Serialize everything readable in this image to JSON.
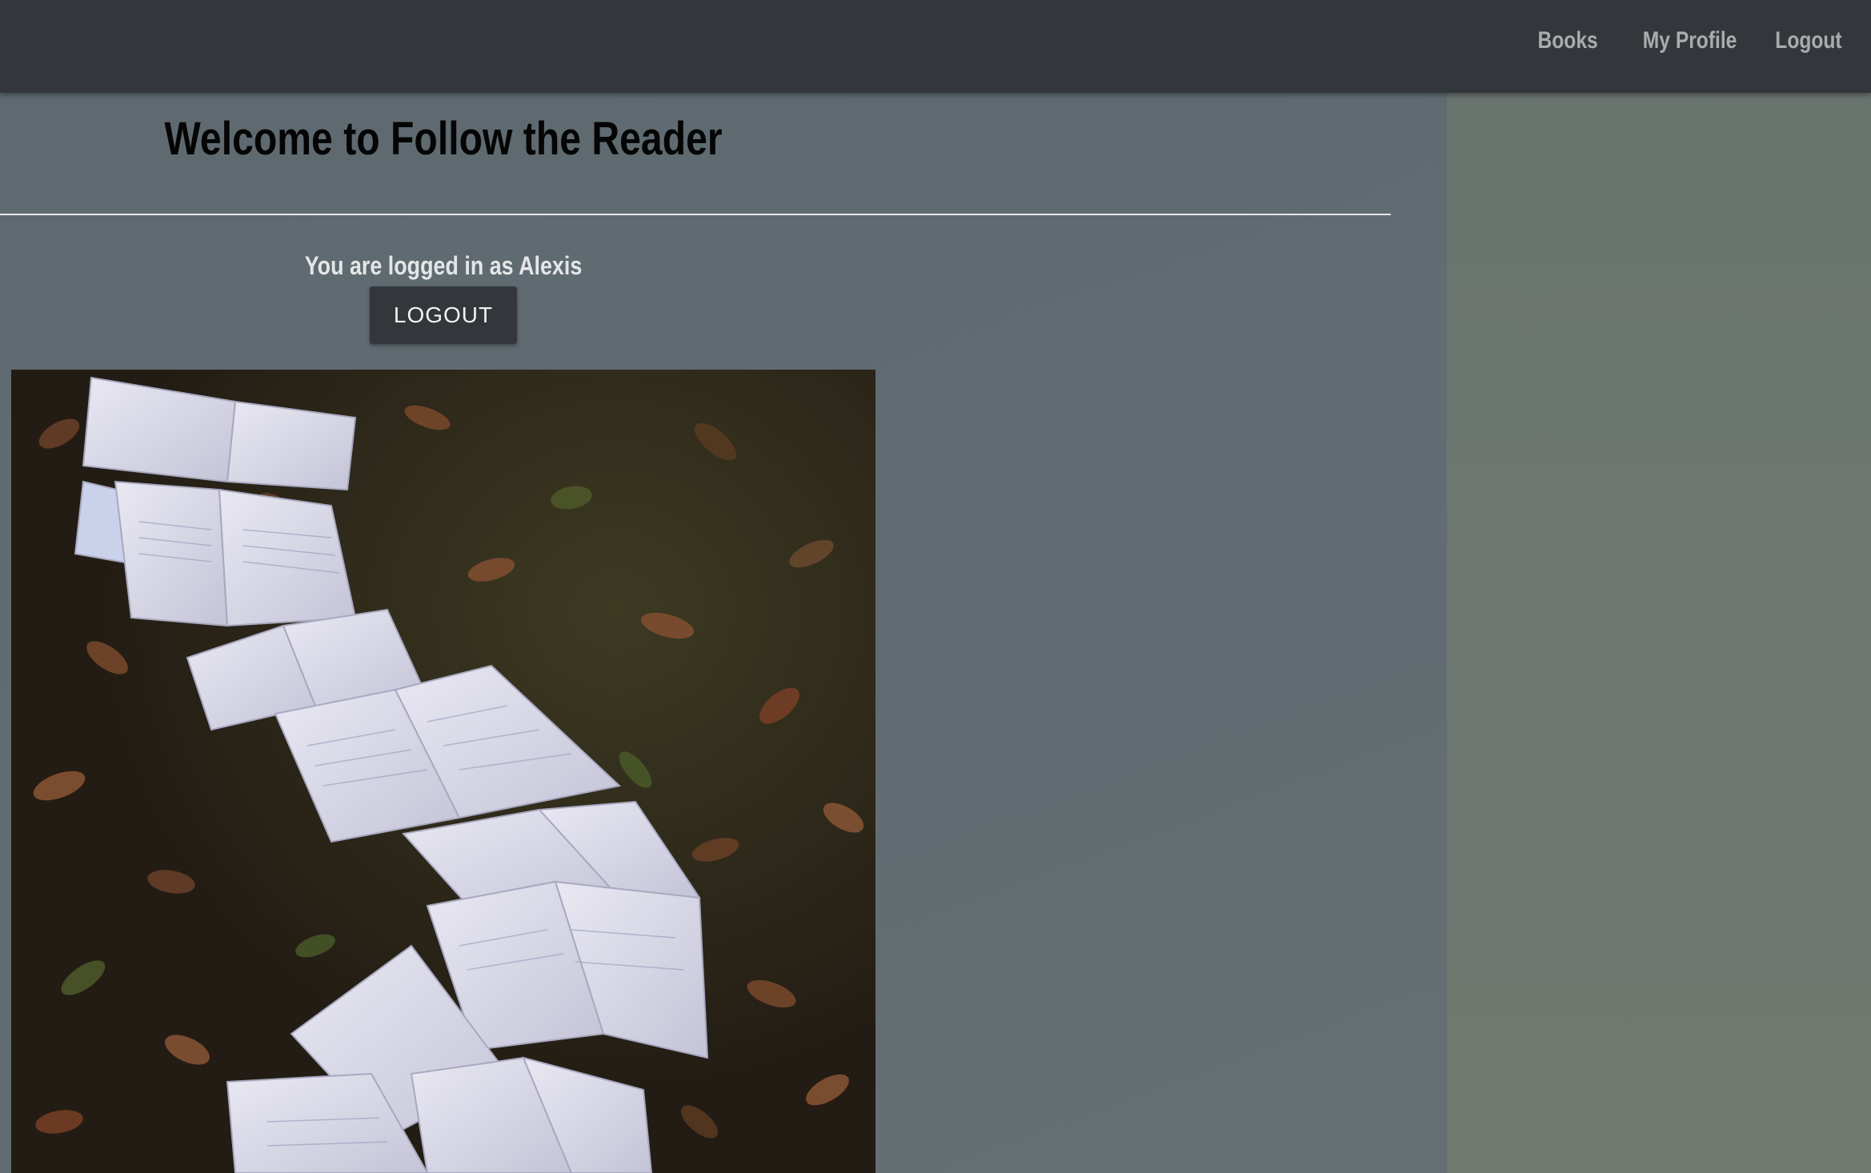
{
  "navbar": {
    "links": [
      {
        "label": "Books"
      },
      {
        "label": "My Profile"
      },
      {
        "label": "Logout"
      }
    ]
  },
  "main": {
    "title": "Welcome to Follow the Reader",
    "login_status": "You are logged in as Alexis",
    "logout_button_label": "LOGOUT",
    "hero_image": {
      "subject": "open books laid in a winding path on autumn leaves and grass"
    }
  },
  "colors": {
    "navbar_bg": "#33373b",
    "main_bg": "#5f6a70",
    "right_panel_bg": "#6e7870",
    "nav_link": "#a9acae",
    "button_bg": "#33373b",
    "button_text": "#f2f2f2"
  }
}
